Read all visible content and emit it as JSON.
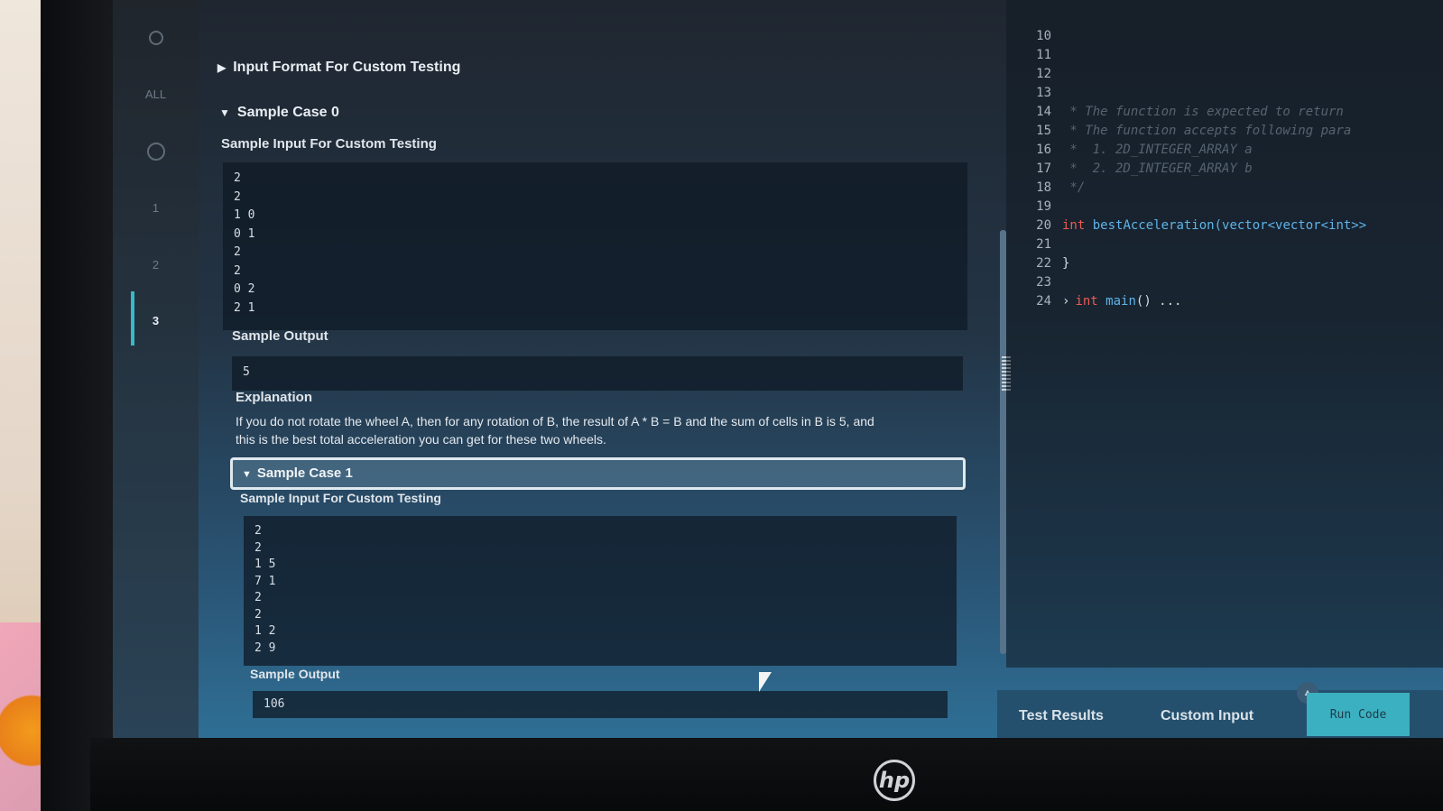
{
  "hardware": {
    "brand_logo": "hp"
  },
  "nav": {
    "all_label": "ALL",
    "items": [
      "1",
      "2",
      "3"
    ],
    "active": "3"
  },
  "problem": {
    "input_format_label": "Input Format For Custom Testing",
    "case0": {
      "title": "Sample Case 0",
      "input_title": "Sample Input For Custom Testing",
      "input_lines": [
        "2",
        "2",
        "1 0",
        "0 1",
        "2",
        "2",
        "0 2",
        "2 1"
      ],
      "output_title": "Sample Output",
      "output": "5",
      "explanation_title": "Explanation",
      "explanation_line1": "If you do not rotate the wheel A, then for any rotation of B, the result of A * B = B and the sum of cells in B is 5, and",
      "explanation_line2": "this is the best total acceleration you can get for these two wheels."
    },
    "case1": {
      "title": "Sample Case 1",
      "input_title": "Sample Input For Custom Testing",
      "input_lines": [
        "2",
        "2",
        "1 5",
        "7 1",
        "2",
        "2",
        "1 2",
        "2 9"
      ],
      "output_title": "Sample Output",
      "output": "106"
    }
  },
  "editor": {
    "lines": [
      {
        "n": "10",
        "text": ""
      },
      {
        "n": "11",
        "text": ""
      },
      {
        "n": "12",
        "text": ""
      },
      {
        "n": "13",
        "text": ""
      },
      {
        "n": "14",
        "text": " * The function is expected to return"
      },
      {
        "n": "15",
        "text": " * The function accepts following para"
      },
      {
        "n": "16",
        "text": " *  1. 2D_INTEGER_ARRAY a"
      },
      {
        "n": "17",
        "text": " *  2. 2D_INTEGER_ARRAY b"
      },
      {
        "n": "18",
        "text": " */"
      },
      {
        "n": "19",
        "text": ""
      },
      {
        "n": "20",
        "text": ""
      },
      {
        "n": "21",
        "text": ""
      },
      {
        "n": "22",
        "text": "}"
      },
      {
        "n": "23",
        "text": ""
      },
      {
        "n": "24",
        "text": ""
      }
    ],
    "line20": {
      "kw": "int",
      "fn": "bestAcceleration",
      "args": "(vector<vector<int>>"
    },
    "line24": {
      "kw": "int",
      "fn": "main",
      "rest": "() ..."
    }
  },
  "bottom": {
    "test_results": "Test Results",
    "custom_input": "Custom Input",
    "run_code": "Run Code"
  },
  "colors": {
    "accent": "#3bb0c0",
    "keyword": "#ef5a4f",
    "function": "#5fb3e8"
  }
}
